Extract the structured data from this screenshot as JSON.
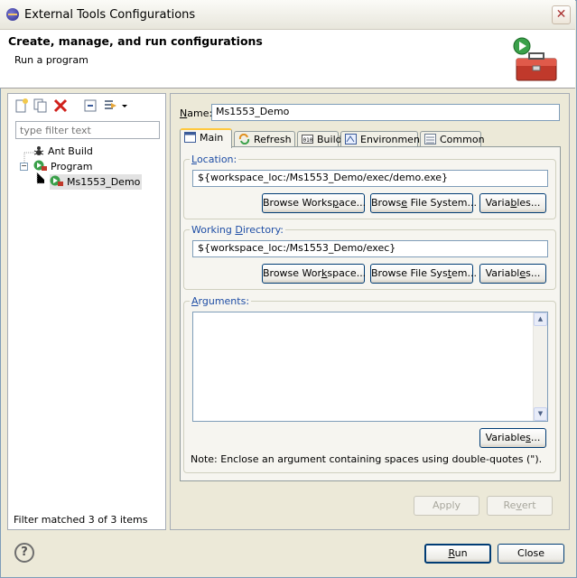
{
  "window": {
    "title": "External Tools Configurations",
    "close_glyph": "✕"
  },
  "banner": {
    "title": "Create, manage, and run configurations",
    "subtitle": "Run a program",
    "icon": "toolbox-run-icon"
  },
  "left": {
    "toolbar": [
      "new-configuration-icon",
      "duplicate-icon",
      "delete-icon",
      "collapse-all-icon",
      "filter-icon"
    ],
    "filter_placeholder": "type filter text",
    "tree": {
      "ant_build": "Ant Build",
      "program": "Program",
      "selected": "Ms1553_Demo"
    },
    "status": "Filter matched 3 of 3 items"
  },
  "right": {
    "name_label": "Name:",
    "name_value": "Ms1553_Demo",
    "tabs": [
      "Main",
      "Refresh",
      "Build",
      "Environment",
      "Common"
    ],
    "location": {
      "legend": "Location:",
      "value": "${workspace_loc:/Ms1553_Demo/exec/demo.exe}"
    },
    "working_dir": {
      "legend": "Working Directory:",
      "value": "${workspace_loc:/Ms1553_Demo/exec}"
    },
    "arguments": {
      "legend": "Arguments:",
      "value": "",
      "note": "Note: Enclose an argument containing spaces using double-quotes (\")."
    },
    "buttons": {
      "browse_workspace": "Browse Workspace...",
      "browse_fs": "Browse File System...",
      "variables": "Variables...",
      "apply": "Apply",
      "revert": "Revert"
    }
  },
  "footer": {
    "run": "Run",
    "close": "Close",
    "help_glyph": "?"
  },
  "colors": {
    "accent_legend": "#1f4ea5",
    "button_border": "#003c74",
    "tab_highlight": "#ffc83c"
  }
}
